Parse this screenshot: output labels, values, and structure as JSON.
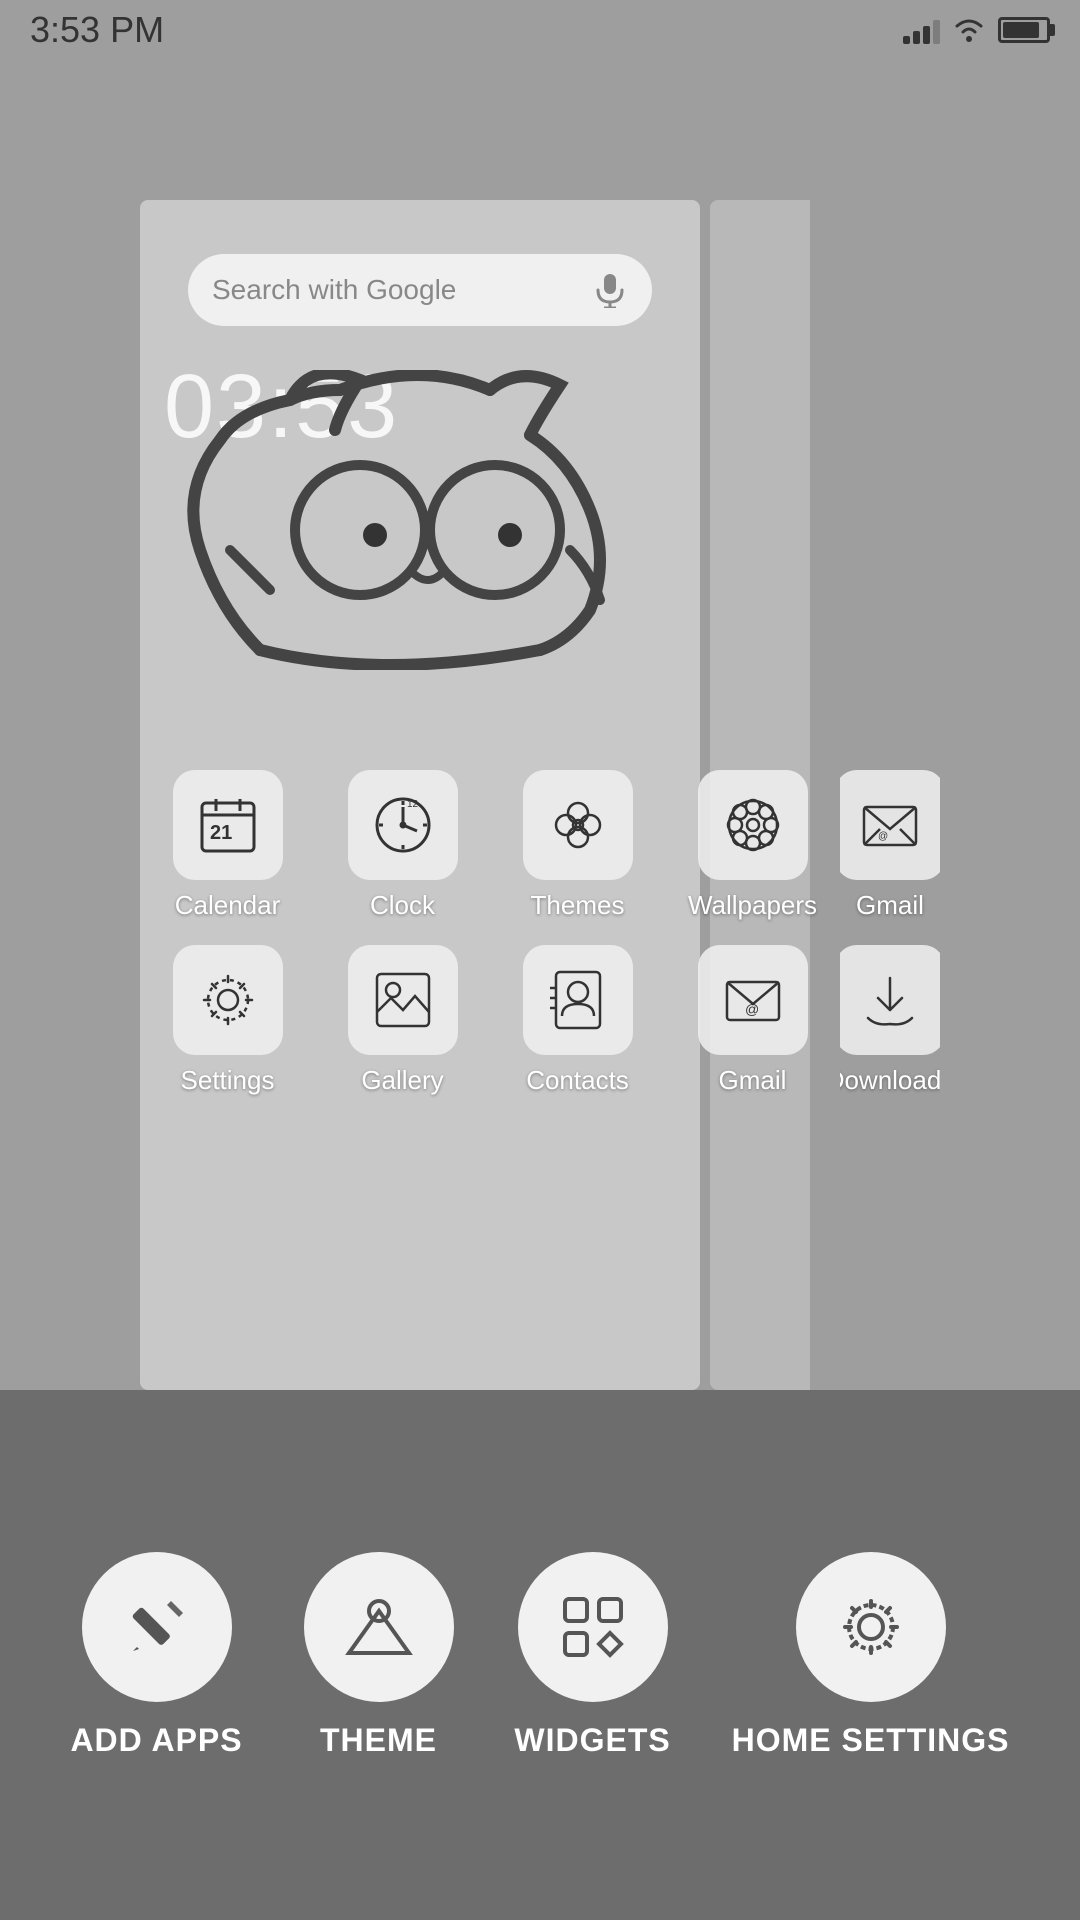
{
  "statusBar": {
    "time": "3:53 PM",
    "batteryPercent": 85
  },
  "searchBar": {
    "placeholder": "Search with Google",
    "micLabel": "microphone"
  },
  "clockDisplay": "03:53",
  "apps": {
    "row1": [
      {
        "id": "calendar",
        "label": "Calendar",
        "icon": "calendar"
      },
      {
        "id": "clock",
        "label": "Clock",
        "icon": "clock"
      },
      {
        "id": "themes",
        "label": "Themes",
        "icon": "themes"
      },
      {
        "id": "wallpapers",
        "label": "Wallpapers",
        "icon": "wallpapers"
      },
      {
        "id": "gmail1",
        "label": "Gmail",
        "icon": "gmail"
      }
    ],
    "row2": [
      {
        "id": "settings",
        "label": "Settings",
        "icon": "settings"
      },
      {
        "id": "gallery",
        "label": "Gallery",
        "icon": "gallery"
      },
      {
        "id": "contacts",
        "label": "Contacts",
        "icon": "contacts"
      },
      {
        "id": "gmail2",
        "label": "Gmail",
        "icon": "gmail"
      },
      {
        "id": "downloads",
        "label": "Downloads",
        "icon": "downloads"
      }
    ]
  },
  "toolbar": {
    "items": [
      {
        "id": "add-apps",
        "label": "ADD APPS",
        "icon": "pencil"
      },
      {
        "id": "theme",
        "label": "THEME",
        "icon": "mountain"
      },
      {
        "id": "widgets",
        "label": "WIDGETS",
        "icon": "widgets"
      },
      {
        "id": "home-settings",
        "label": "HOME SETTINGS",
        "icon": "gear"
      }
    ]
  }
}
